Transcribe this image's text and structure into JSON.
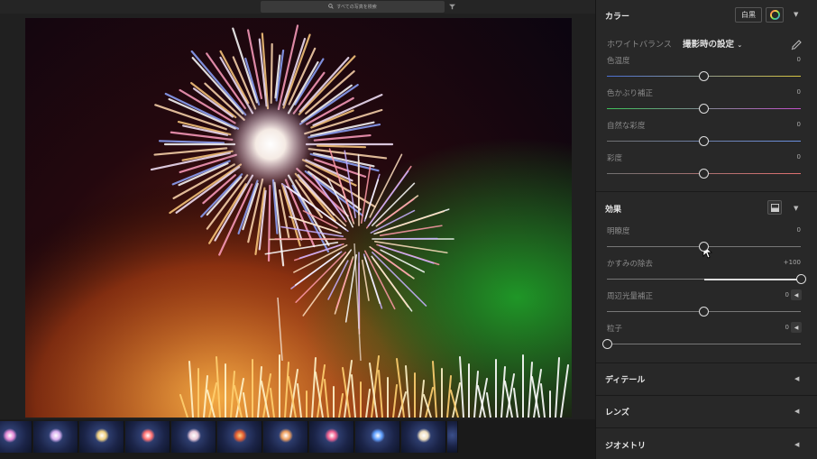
{
  "search": {
    "placeholder": "すべての写真を検索"
  },
  "color": {
    "title": "カラー",
    "bw_label": "白黒",
    "white_balance_label": "ホワイトバランス",
    "white_balance_value": "撮影時の設定",
    "sliders": [
      {
        "label": "色温度",
        "value": "0",
        "level": 0.5
      },
      {
        "label": "色かぶり補正",
        "value": "0",
        "level": 0.5
      },
      {
        "label": "自然な彩度",
        "value": "0",
        "level": 0.5
      },
      {
        "label": "彩度",
        "value": "0",
        "level": 0.5
      }
    ]
  },
  "effects": {
    "title": "効果",
    "sliders": [
      {
        "label": "明瞭度",
        "value": "0",
        "level": 0.5
      },
      {
        "label": "かすみの除去",
        "value": "+100",
        "level": 1.0
      },
      {
        "label": "周辺光量補正",
        "value": "0",
        "level": 0.5
      },
      {
        "label": "粒子",
        "value": "0",
        "level": 0.0
      }
    ]
  },
  "collapsed_sections": {
    "detail": "ディテール",
    "lens": "レンズ",
    "geometry": "ジオメトリ"
  },
  "colors": {
    "panel_bg": "#282828",
    "accent_knob": "#dddddd",
    "temp_track": [
      "#4a6fd6",
      "#d8c640"
    ],
    "tint_track": [
      "#3ec25a",
      "#c24fc9"
    ],
    "vibrance_track": [
      "#707070",
      "#6a8fe0"
    ],
    "saturation_track": [
      "#707070",
      "#e07070"
    ]
  },
  "icons": {
    "search": "search-icon",
    "filter": "filter-icon",
    "color_wheel": "color-wheel-icon",
    "eyedropper": "eyedropper-icon",
    "vignette_toggle": "vignette-icon"
  }
}
